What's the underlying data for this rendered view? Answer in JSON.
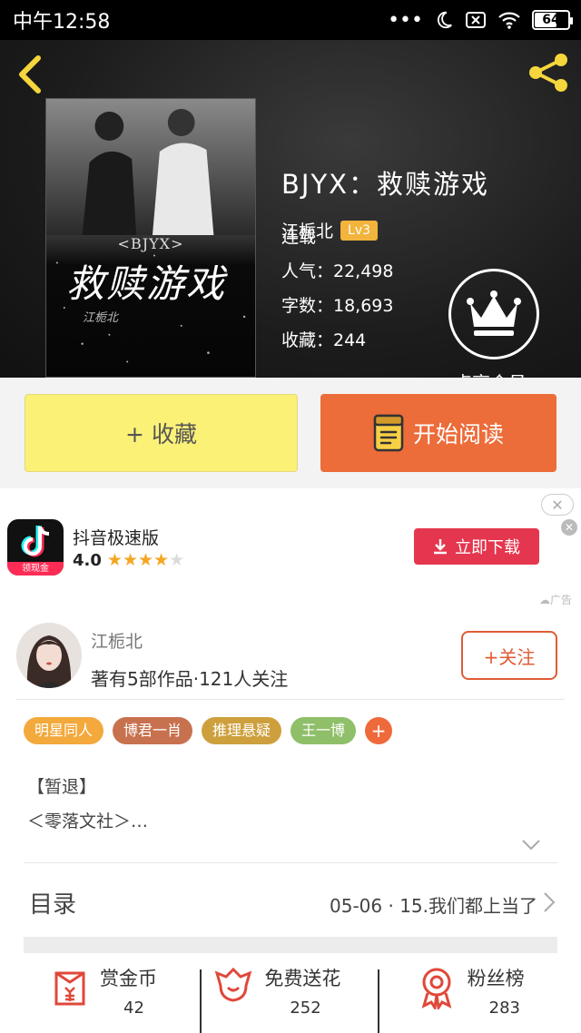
{
  "status_bar": {
    "time": "中午12:58",
    "battery": "64"
  },
  "book": {
    "title": "BJYX：救赎游戏",
    "author": "江栀北",
    "level": "Lv3",
    "status": "连载",
    "popularity": "人气：22,498",
    "word_count": "字数：18,693",
    "favorites": "收藏：244",
    "cover": {
      "subtitle": "<BJYX>",
      "title": "救赎游戏",
      "author": "江栀北"
    }
  },
  "vip": {
    "label": "点亮会员"
  },
  "actions": {
    "favorite": "+ 收藏",
    "read": "开始阅读"
  },
  "ad": {
    "app_name": "抖音极速版",
    "rating": "4.0",
    "stars_filled": 4,
    "stars_total": 5,
    "badge": "领现金",
    "download": "立即下载",
    "close": "✕",
    "tag": "广告"
  },
  "author_section": {
    "name": "江栀北",
    "stats": "著有5部作品·121人关注",
    "follow": "+关注",
    "tags": [
      {
        "label": "明星同人",
        "color": "#f3a93b"
      },
      {
        "label": "博君一肖",
        "color": "#c8714f"
      },
      {
        "label": "推理悬疑",
        "color": "#cda03d"
      },
      {
        "label": "王一博",
        "color": "#8fbf69"
      }
    ],
    "tag_add": "+",
    "desc_line1": "【暂退】",
    "desc_line2": "＜零落文社＞…"
  },
  "toc": {
    "label": "目录",
    "latest": "05-06 · 15.我们都上当了"
  },
  "bottom_stats": [
    {
      "label": "赏金币",
      "value": "42"
    },
    {
      "label": "免费送花",
      "value": "252"
    },
    {
      "label": "粉丝榜",
      "value": "283"
    }
  ]
}
